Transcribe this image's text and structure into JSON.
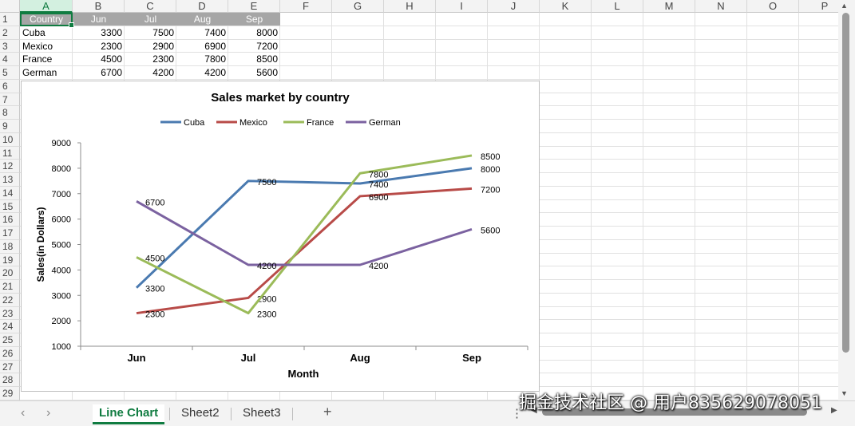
{
  "columns": [
    "A",
    "B",
    "C",
    "D",
    "E",
    "F",
    "G",
    "H",
    "I",
    "J",
    "K",
    "L",
    "M",
    "N",
    "O",
    "P"
  ],
  "rows": [
    1,
    2,
    3,
    4,
    5,
    6,
    7,
    8,
    9,
    10,
    11,
    12,
    13,
    14,
    15,
    16,
    17,
    18,
    19,
    20,
    21,
    22,
    23,
    24,
    25,
    26,
    27,
    28,
    29
  ],
  "selected_column": "A",
  "table": {
    "headers": [
      "Country",
      "Jun",
      "Jul",
      "Aug",
      "Sep"
    ],
    "rows": [
      [
        "Cuba",
        "3300",
        "7500",
        "7400",
        "8000"
      ],
      [
        "Mexico",
        "2300",
        "2900",
        "6900",
        "7200"
      ],
      [
        "France",
        "4500",
        "2300",
        "7800",
        "8500"
      ],
      [
        "German",
        "6700",
        "4200",
        "4200",
        "5600"
      ]
    ]
  },
  "chart_data": {
    "type": "line",
    "title": "Sales market by country",
    "xlabel": "Month",
    "ylabel": "Sales(in Dollars)",
    "categories": [
      "Jun",
      "Jul",
      "Aug",
      "Sep"
    ],
    "ylim": [
      1000,
      9000
    ],
    "yticks": [
      "1000",
      "2000",
      "3000",
      "4000",
      "5000",
      "6000",
      "7000",
      "8000",
      "9000"
    ],
    "legend_position": "top",
    "grid": false,
    "series": [
      {
        "name": "Cuba",
        "color": "#4a7ab0",
        "values": [
          3300,
          7500,
          7400,
          8000
        ]
      },
      {
        "name": "Mexico",
        "color": "#b84b48",
        "values": [
          2300,
          2900,
          6900,
          7200
        ]
      },
      {
        "name": "France",
        "color": "#9bbb59",
        "values": [
          4500,
          2300,
          7800,
          8500
        ]
      },
      {
        "name": "German",
        "color": "#7b62a0",
        "values": [
          6700,
          4200,
          4200,
          5600
        ]
      }
    ]
  },
  "tabs": {
    "prev_icon": "‹",
    "next_icon": "›",
    "items": [
      "Line Chart",
      "Sheet2",
      "Sheet3"
    ],
    "add_icon": "+",
    "more_icon": "⋮"
  },
  "watermark": "掘金技术社区 @ 用户835629078051",
  "colors": {
    "accent": "#107c41",
    "header_fill": "#a6a6a6"
  }
}
